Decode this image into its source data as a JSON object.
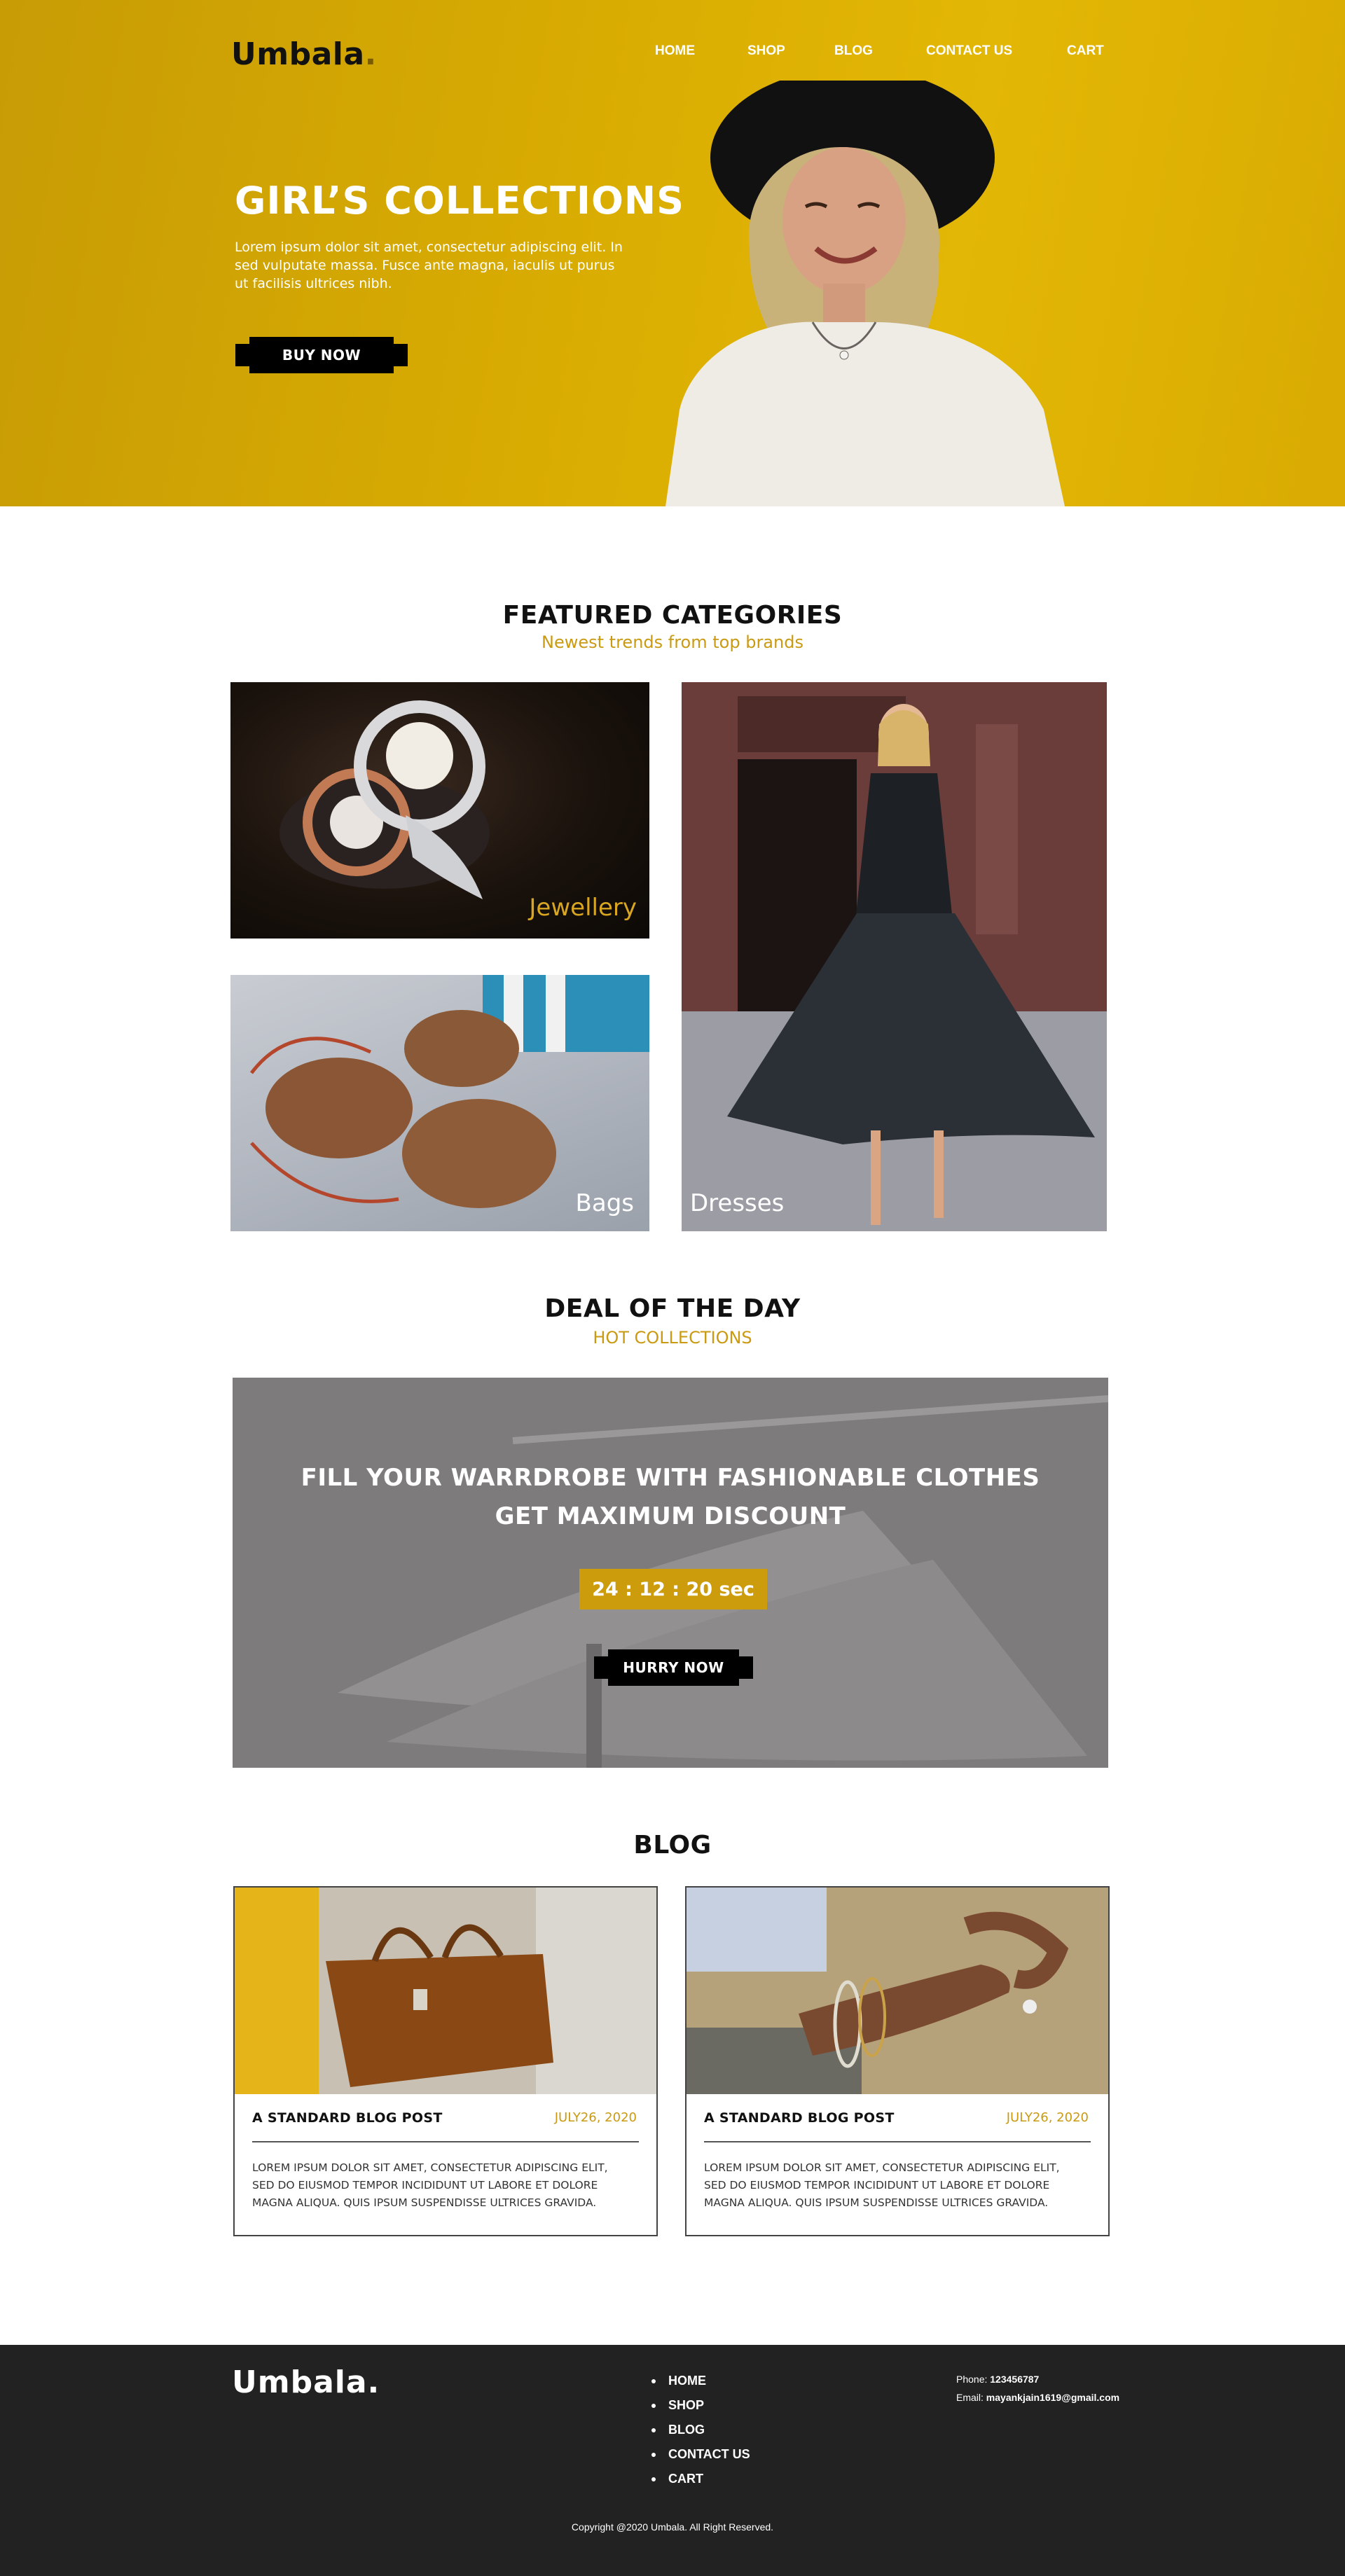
{
  "brand": {
    "name": "Umbala",
    "dot": ".",
    "footer_name": "Umbala."
  },
  "nav": [
    {
      "label": "HOME"
    },
    {
      "label": "SHOP"
    },
    {
      "label": "BLOG"
    },
    {
      "label": "CONTACT US"
    },
    {
      "label": "CART"
    }
  ],
  "hero": {
    "title": "GIRL’S COLLECTIONS",
    "text": "Lorem ipsum dolor sit amet, consectetur adipiscing elit. In sed vulputate massa. Fusce ante magna, iaculis ut purus ut facilisis ultrices nibh.",
    "button": "BUY NOW",
    "bg_color": "#d9ab03"
  },
  "featured": {
    "title": "FEATURED CATEGORIES",
    "subtitle": "Newest trends from top brands",
    "tiles": [
      {
        "label": "Jewellery",
        "label_color": "#d9a621"
      },
      {
        "label": "Bags",
        "label_color": "#ffffff"
      },
      {
        "label": "Dresses",
        "label_color": "#ffffff"
      }
    ]
  },
  "deal": {
    "title": "DEAL OF THE DAY",
    "subtitle": "HOT COLLECTIONS",
    "line1": "FILL YOUR WARRDROBE WITH FASHIONABLE CLOTHES",
    "line2": "GET MAXIMUM DISCOUNT",
    "timer": "24 : 12 : 20 sec",
    "button": "HURRY NOW",
    "timer_color": "#cc9c0c"
  },
  "blog": {
    "title": "BLOG",
    "posts": [
      {
        "title": "A STANDARD BLOG POST",
        "date": "JULY26, 2020",
        "body": "LOREM IPSUM DOLOR SIT AMET, CONSECTETUR ADIPISCING ELIT, SED DO EIUSMOD TEMPOR INCIDIDUNT UT LABORE ET DOLORE MAGNA ALIQUA. QUIS IPSUM SUSPENDISSE ULTRICES GRAVIDA."
      },
      {
        "title": "A STANDARD BLOG POST",
        "date": "JULY26, 2020",
        "body": "LOREM IPSUM DOLOR SIT AMET, CONSECTETUR ADIPISCING ELIT, SED DO EIUSMOD TEMPOR INCIDIDUNT UT LABORE ET DOLORE MAGNA ALIQUA. QUIS IPSUM SUSPENDISSE ULTRICES GRAVIDA."
      }
    ]
  },
  "footer": {
    "links": [
      "HOME",
      "SHOP",
      "BLOG",
      "CONTACT US",
      "CART"
    ],
    "phone_label": "Phone:",
    "phone": "123456787",
    "email_label": "Email:",
    "email": "mayankjain1619@gmail.com",
    "copyright": "Copyright @2020 Umbala. All Right Reserved.",
    "bg_color": "#222222"
  }
}
